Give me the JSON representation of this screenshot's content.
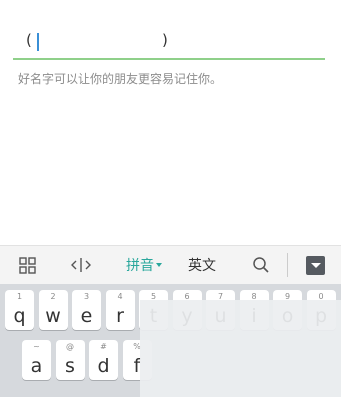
{
  "name_field": {
    "left_paren": "(",
    "right_paren": ")"
  },
  "hint": "好名字可以让你的朋友更容易记住你。",
  "toolbar": {
    "grid_icon": "grid-icon",
    "cursor_icon": "cursor-move-icon",
    "pinyin_label": "拼音",
    "english_label": "英文",
    "search_icon": "search-icon",
    "hide_icon": "keyboard-hide-icon",
    "accent_color": "#2aa79c"
  },
  "keyboard": {
    "row1": [
      {
        "main": "q",
        "sub": "1"
      },
      {
        "main": "w",
        "sub": "2"
      },
      {
        "main": "e",
        "sub": "3"
      },
      {
        "main": "r",
        "sub": "4"
      },
      {
        "main": "t",
        "sub": "5"
      },
      {
        "main": "y",
        "sub": "6"
      },
      {
        "main": "u",
        "sub": "7"
      },
      {
        "main": "i",
        "sub": "8"
      },
      {
        "main": "o",
        "sub": "9"
      },
      {
        "main": "p",
        "sub": "0"
      }
    ],
    "row2": [
      {
        "main": "a",
        "sub": "~"
      },
      {
        "main": "s",
        "sub": "@"
      },
      {
        "main": "d",
        "sub": "#"
      },
      {
        "main": "f",
        "sub": "%"
      }
    ]
  }
}
